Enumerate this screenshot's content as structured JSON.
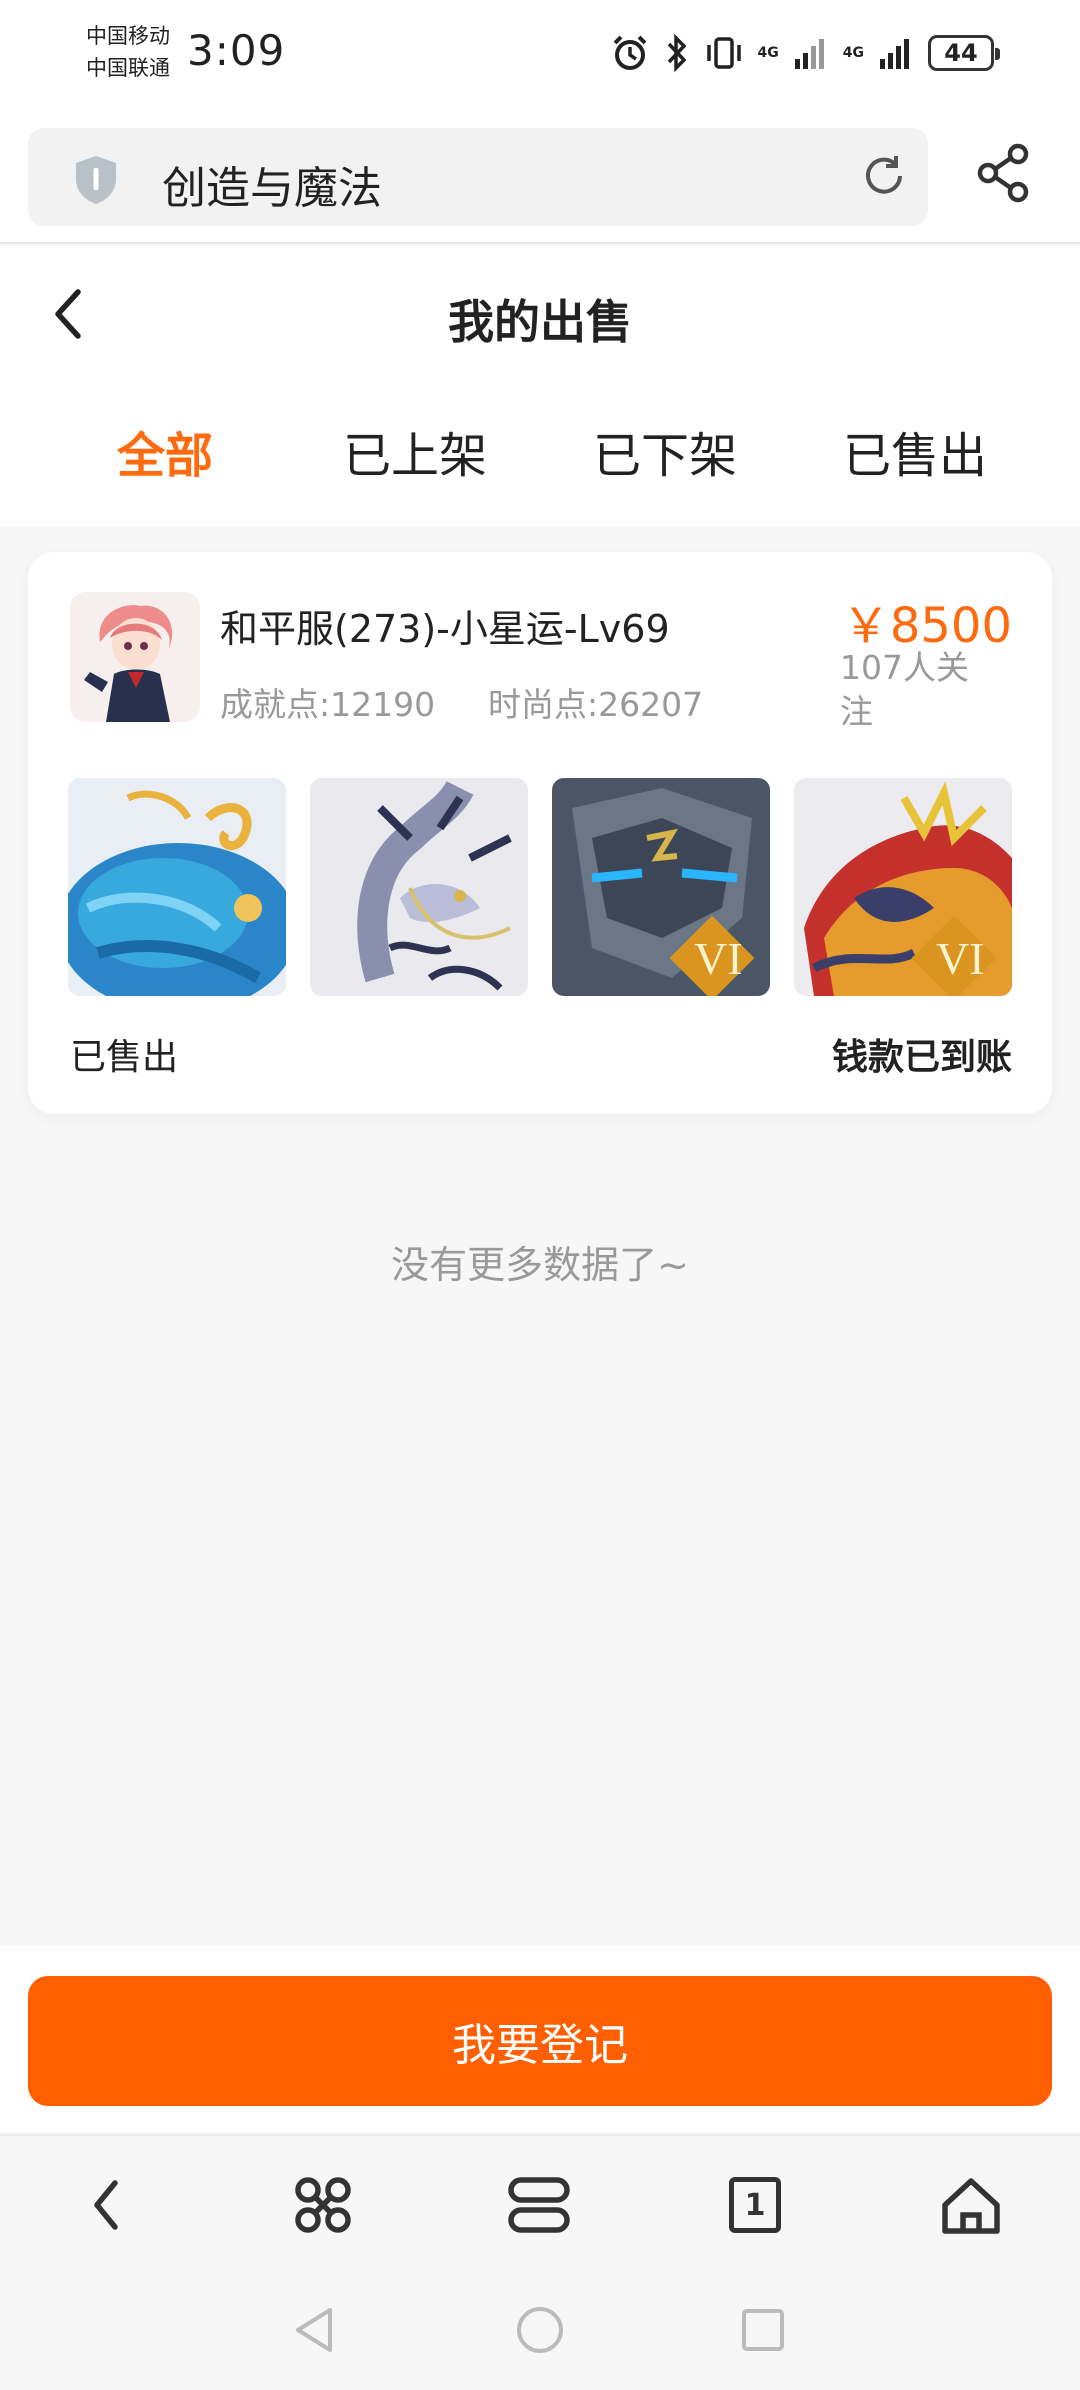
{
  "status_bar": {
    "carrier_1": "中国移动",
    "carrier_2": "中国联通",
    "time": "3:09",
    "network_1": "4G",
    "network_2": "4G",
    "battery": "44"
  },
  "browser": {
    "site_title": "创造与魔法"
  },
  "header": {
    "title": "我的出售"
  },
  "tabs": [
    {
      "label": "全部",
      "active": true
    },
    {
      "label": "已上架",
      "active": false
    },
    {
      "label": "已下架",
      "active": false
    },
    {
      "label": "已售出",
      "active": false
    }
  ],
  "listing": {
    "title": "和平服(273)-小星运-Lv69",
    "achievement": "成就点:12190",
    "fashion": "时尚点:26207",
    "price": "￥8500",
    "followers": "107人关注",
    "status": "已售出",
    "payment_status": "钱款已到账",
    "badge_label": "VI"
  },
  "footer_note": "没有更多数据了~",
  "action": {
    "register_label": "我要登记"
  },
  "colors": {
    "accent": "#ff6a0f",
    "button": "#ff5f00"
  }
}
